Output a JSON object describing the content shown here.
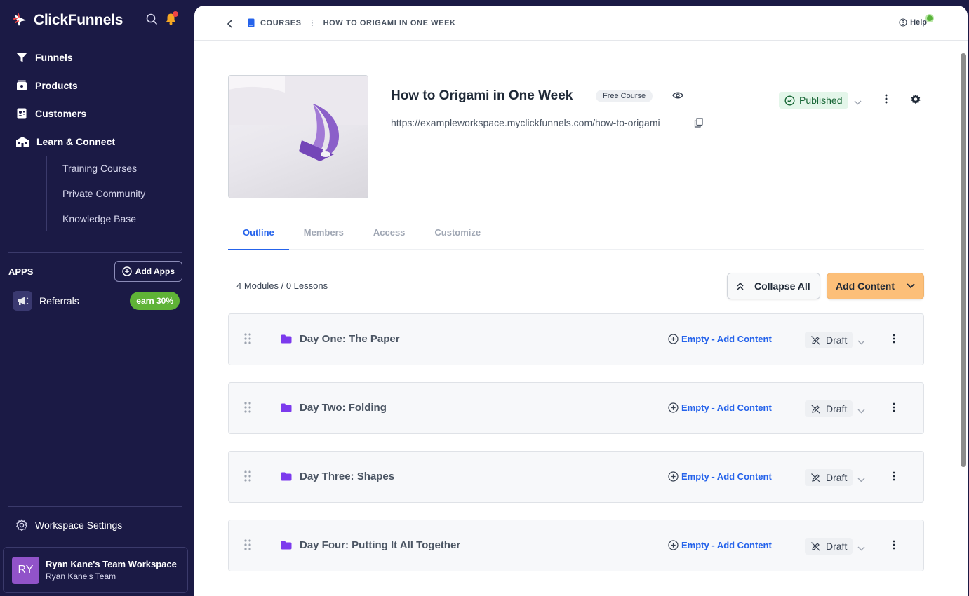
{
  "sidebar": {
    "brand": "ClickFunnels",
    "nav": [
      {
        "label": "Funnels",
        "icon": "funnel-icon"
      },
      {
        "label": "Products",
        "icon": "products-icon"
      },
      {
        "label": "Customers",
        "icon": "customers-icon"
      },
      {
        "label": "Learn & Connect",
        "icon": "learn-connect-icon"
      }
    ],
    "subnav": [
      "Training Courses",
      "Private Community",
      "Knowledge Base"
    ],
    "apps_label": "APPS",
    "add_apps": "Add Apps",
    "referral": {
      "label": "Referrals",
      "badge": "earn 30%"
    },
    "workspace_settings": "Workspace Settings",
    "account": {
      "initials": "RY",
      "name": "Ryan Kane's Team Workspace",
      "team": "Ryan Kane's Team"
    }
  },
  "header": {
    "breadcrumb": [
      "COURSES",
      "HOW TO ORIGAMI IN ONE WEEK"
    ],
    "help": "Help"
  },
  "course": {
    "title": "How to Origami in One Week",
    "badge": "Free Course",
    "url": "https://exampleworkspace.myclickfunnels.com/how-to-origami",
    "status": "Published"
  },
  "tabs": [
    "Outline",
    "Members",
    "Access",
    "Customize"
  ],
  "outline": {
    "summary": "4 Modules / 0 Lessons",
    "collapse_label": "Collapse All",
    "add_content_label": "Add Content",
    "modules": [
      {
        "title": "Day One: The Paper",
        "empty_label": "Empty - Add Content",
        "status": "Draft"
      },
      {
        "title": "Day Two: Folding",
        "empty_label": "Empty - Add Content",
        "status": "Draft"
      },
      {
        "title": "Day Three: Shapes",
        "empty_label": "Empty - Add Content",
        "status": "Draft"
      },
      {
        "title": "Day Four: Putting It All Together",
        "empty_label": "Empty - Add Content",
        "status": "Draft"
      }
    ]
  },
  "colors": {
    "sidebar": "#1b1a45",
    "accent": "#2563eb",
    "cta": "#fcbf79",
    "published": "#e4f6ea",
    "folder": "#7c3aed"
  }
}
